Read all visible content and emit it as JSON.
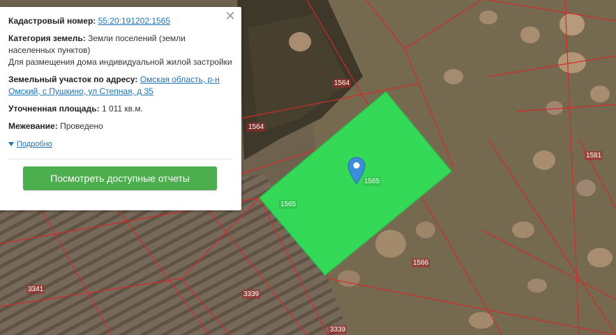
{
  "popup": {
    "cadastral_label": "Кадастровый номер:",
    "cadastral_number": "55:20:191202:1565",
    "category_label": "Категория земель:",
    "category_value": "Земли поселений (земли населенных пунктов)",
    "usage_text": "Для размещения дома индивидуальной жилой застройки",
    "address_label": "Земельный участок по адресу:",
    "address_value": "Омская область, р-н Омский, с Пушкино, ул Степная, д 35",
    "area_label": "Уточненная площадь:",
    "area_value": "1 011 кв.м.",
    "survey_label": "Межевание:",
    "survey_value": "Проведено",
    "more_link": "Подробно",
    "report_button": "Посмотреть доступные отчеты",
    "close_icon": "close-icon"
  },
  "map": {
    "labels": [
      "1564",
      "1564",
      "1565",
      "1565",
      "1581",
      "1566",
      "3341",
      "3339",
      "3339"
    ],
    "highlight_color": "#2ee65a",
    "boundary_color": "#d42a2a",
    "marker_icon": "map-pin-icon",
    "marker_color": "#3a8fd8"
  }
}
